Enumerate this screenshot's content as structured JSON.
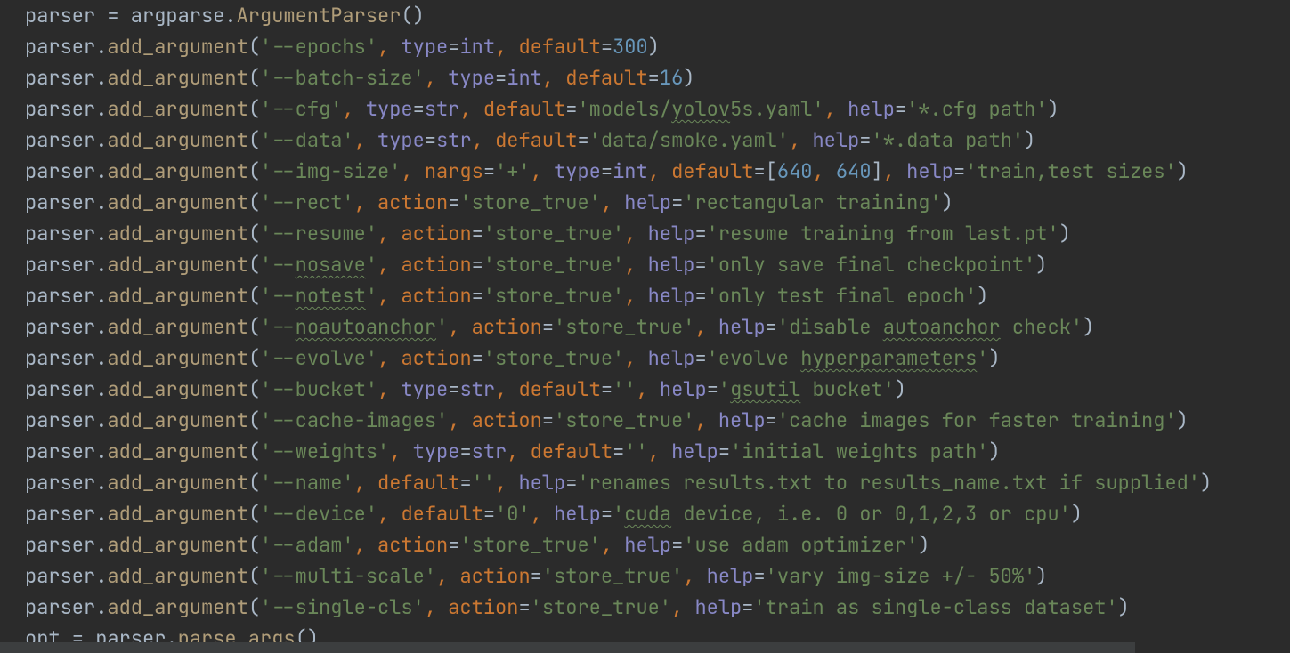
{
  "lines": [
    [
      {
        "t": "parser = argparse.",
        "c": "t-default"
      },
      {
        "t": "ArgumentParser",
        "c": "t-call"
      },
      {
        "t": "()",
        "c": "t-default"
      }
    ],
    [
      {
        "t": "parser.",
        "c": "t-default"
      },
      {
        "t": "add_argument",
        "c": "t-call"
      },
      {
        "t": "(",
        "c": "t-default"
      },
      {
        "t": "'--epochs'",
        "c": "t-string"
      },
      {
        "t": ", ",
        "c": "t-comma"
      },
      {
        "t": "type",
        "c": "t-builtin"
      },
      {
        "t": "=",
        "c": "t-default"
      },
      {
        "t": "int",
        "c": "t-builtin"
      },
      {
        "t": ", ",
        "c": "t-comma"
      },
      {
        "t": "default",
        "c": "t-keyword"
      },
      {
        "t": "=",
        "c": "t-default"
      },
      {
        "t": "300",
        "c": "t-number"
      },
      {
        "t": ")",
        "c": "t-default"
      }
    ],
    [
      {
        "t": "parser.",
        "c": "t-default"
      },
      {
        "t": "add_argument",
        "c": "t-call"
      },
      {
        "t": "(",
        "c": "t-default"
      },
      {
        "t": "'--batch-size'",
        "c": "t-string"
      },
      {
        "t": ", ",
        "c": "t-comma"
      },
      {
        "t": "type",
        "c": "t-builtin"
      },
      {
        "t": "=",
        "c": "t-default"
      },
      {
        "t": "int",
        "c": "t-builtin"
      },
      {
        "t": ", ",
        "c": "t-comma"
      },
      {
        "t": "default",
        "c": "t-keyword"
      },
      {
        "t": "=",
        "c": "t-default"
      },
      {
        "t": "16",
        "c": "t-number"
      },
      {
        "t": ")",
        "c": "t-default"
      }
    ],
    [
      {
        "t": "parser.",
        "c": "t-default"
      },
      {
        "t": "add_argument",
        "c": "t-call"
      },
      {
        "t": "(",
        "c": "t-default"
      },
      {
        "t": "'--cfg'",
        "c": "t-string"
      },
      {
        "t": ", ",
        "c": "t-comma"
      },
      {
        "t": "type",
        "c": "t-builtin"
      },
      {
        "t": "=",
        "c": "t-default"
      },
      {
        "t": "str",
        "c": "t-builtin"
      },
      {
        "t": ", ",
        "c": "t-comma"
      },
      {
        "t": "default",
        "c": "t-keyword"
      },
      {
        "t": "=",
        "c": "t-default"
      },
      {
        "t": "'models/",
        "c": "t-string"
      },
      {
        "t": "yolov",
        "c": "t-string typo"
      },
      {
        "t": "5s.yaml'",
        "c": "t-string"
      },
      {
        "t": ", ",
        "c": "t-comma"
      },
      {
        "t": "help",
        "c": "t-builtin"
      },
      {
        "t": "=",
        "c": "t-default"
      },
      {
        "t": "'*.cfg path'",
        "c": "t-string"
      },
      {
        "t": ")",
        "c": "t-default"
      }
    ],
    [
      {
        "t": "parser.",
        "c": "t-default"
      },
      {
        "t": "add_argument",
        "c": "t-call"
      },
      {
        "t": "(",
        "c": "t-default"
      },
      {
        "t": "'--data'",
        "c": "t-string"
      },
      {
        "t": ", ",
        "c": "t-comma"
      },
      {
        "t": "type",
        "c": "t-builtin"
      },
      {
        "t": "=",
        "c": "t-default"
      },
      {
        "t": "str",
        "c": "t-builtin"
      },
      {
        "t": ", ",
        "c": "t-comma"
      },
      {
        "t": "default",
        "c": "t-keyword"
      },
      {
        "t": "=",
        "c": "t-default"
      },
      {
        "t": "'data/smoke.yaml'",
        "c": "t-string"
      },
      {
        "t": ", ",
        "c": "t-comma"
      },
      {
        "t": "help",
        "c": "t-builtin"
      },
      {
        "t": "=",
        "c": "t-default"
      },
      {
        "t": "'*.data path'",
        "c": "t-string"
      },
      {
        "t": ")",
        "c": "t-default"
      }
    ],
    [
      {
        "t": "parser.",
        "c": "t-default"
      },
      {
        "t": "add_argument",
        "c": "t-call"
      },
      {
        "t": "(",
        "c": "t-default"
      },
      {
        "t": "'--img-size'",
        "c": "t-string"
      },
      {
        "t": ", ",
        "c": "t-comma"
      },
      {
        "t": "nargs",
        "c": "t-keyword"
      },
      {
        "t": "=",
        "c": "t-default"
      },
      {
        "t": "'+'",
        "c": "t-string"
      },
      {
        "t": ", ",
        "c": "t-comma"
      },
      {
        "t": "type",
        "c": "t-builtin"
      },
      {
        "t": "=",
        "c": "t-default"
      },
      {
        "t": "int",
        "c": "t-builtin"
      },
      {
        "t": ", ",
        "c": "t-comma"
      },
      {
        "t": "default",
        "c": "t-keyword"
      },
      {
        "t": "=[",
        "c": "t-default"
      },
      {
        "t": "640",
        "c": "t-number"
      },
      {
        "t": ", ",
        "c": "t-comma"
      },
      {
        "t": "640",
        "c": "t-number"
      },
      {
        "t": "]",
        "c": "t-default"
      },
      {
        "t": ", ",
        "c": "t-comma"
      },
      {
        "t": "help",
        "c": "t-builtin"
      },
      {
        "t": "=",
        "c": "t-default"
      },
      {
        "t": "'train,test sizes'",
        "c": "t-string"
      },
      {
        "t": ")",
        "c": "t-default"
      }
    ],
    [
      {
        "t": "parser.",
        "c": "t-default"
      },
      {
        "t": "add_argument",
        "c": "t-call"
      },
      {
        "t": "(",
        "c": "t-default"
      },
      {
        "t": "'--rect'",
        "c": "t-string"
      },
      {
        "t": ", ",
        "c": "t-comma"
      },
      {
        "t": "action",
        "c": "t-keyword"
      },
      {
        "t": "=",
        "c": "t-default"
      },
      {
        "t": "'store_true'",
        "c": "t-string"
      },
      {
        "t": ", ",
        "c": "t-comma"
      },
      {
        "t": "help",
        "c": "t-builtin"
      },
      {
        "t": "=",
        "c": "t-default"
      },
      {
        "t": "'rectangular training'",
        "c": "t-string"
      },
      {
        "t": ")",
        "c": "t-default"
      }
    ],
    [
      {
        "t": "parser.",
        "c": "t-default"
      },
      {
        "t": "add_argument",
        "c": "t-call"
      },
      {
        "t": "(",
        "c": "t-default"
      },
      {
        "t": "'--resume'",
        "c": "t-string"
      },
      {
        "t": ", ",
        "c": "t-comma"
      },
      {
        "t": "action",
        "c": "t-keyword"
      },
      {
        "t": "=",
        "c": "t-default"
      },
      {
        "t": "'store_true'",
        "c": "t-string"
      },
      {
        "t": ", ",
        "c": "t-comma"
      },
      {
        "t": "help",
        "c": "t-builtin"
      },
      {
        "t": "=",
        "c": "t-default"
      },
      {
        "t": "'resume training from last.pt'",
        "c": "t-string"
      },
      {
        "t": ")",
        "c": "t-default"
      }
    ],
    [
      {
        "t": "parser.",
        "c": "t-default"
      },
      {
        "t": "add_argument",
        "c": "t-call"
      },
      {
        "t": "(",
        "c": "t-default"
      },
      {
        "t": "'--",
        "c": "t-string"
      },
      {
        "t": "nosave",
        "c": "t-string typo"
      },
      {
        "t": "'",
        "c": "t-string"
      },
      {
        "t": ", ",
        "c": "t-comma"
      },
      {
        "t": "action",
        "c": "t-keyword"
      },
      {
        "t": "=",
        "c": "t-default"
      },
      {
        "t": "'store_true'",
        "c": "t-string"
      },
      {
        "t": ", ",
        "c": "t-comma"
      },
      {
        "t": "help",
        "c": "t-builtin"
      },
      {
        "t": "=",
        "c": "t-default"
      },
      {
        "t": "'only save final checkpoint'",
        "c": "t-string"
      },
      {
        "t": ")",
        "c": "t-default"
      }
    ],
    [
      {
        "t": "parser.",
        "c": "t-default"
      },
      {
        "t": "add_argument",
        "c": "t-call"
      },
      {
        "t": "(",
        "c": "t-default"
      },
      {
        "t": "'--",
        "c": "t-string"
      },
      {
        "t": "notest",
        "c": "t-string typo"
      },
      {
        "t": "'",
        "c": "t-string"
      },
      {
        "t": ", ",
        "c": "t-comma"
      },
      {
        "t": "action",
        "c": "t-keyword"
      },
      {
        "t": "=",
        "c": "t-default"
      },
      {
        "t": "'store_true'",
        "c": "t-string"
      },
      {
        "t": ", ",
        "c": "t-comma"
      },
      {
        "t": "help",
        "c": "t-builtin"
      },
      {
        "t": "=",
        "c": "t-default"
      },
      {
        "t": "'only test final epoch'",
        "c": "t-string"
      },
      {
        "t": ")",
        "c": "t-default"
      }
    ],
    [
      {
        "t": "parser.",
        "c": "t-default"
      },
      {
        "t": "add_argument",
        "c": "t-call"
      },
      {
        "t": "(",
        "c": "t-default"
      },
      {
        "t": "'--",
        "c": "t-string"
      },
      {
        "t": "noautoanchor",
        "c": "t-string typo"
      },
      {
        "t": "'",
        "c": "t-string"
      },
      {
        "t": ", ",
        "c": "t-comma"
      },
      {
        "t": "action",
        "c": "t-keyword"
      },
      {
        "t": "=",
        "c": "t-default"
      },
      {
        "t": "'store_true'",
        "c": "t-string"
      },
      {
        "t": ", ",
        "c": "t-comma"
      },
      {
        "t": "help",
        "c": "t-builtin"
      },
      {
        "t": "=",
        "c": "t-default"
      },
      {
        "t": "'disable ",
        "c": "t-string"
      },
      {
        "t": "autoanchor",
        "c": "t-string typo"
      },
      {
        "t": " check'",
        "c": "t-string"
      },
      {
        "t": ")",
        "c": "t-default"
      }
    ],
    [
      {
        "t": "parser.",
        "c": "t-default"
      },
      {
        "t": "add_argument",
        "c": "t-call"
      },
      {
        "t": "(",
        "c": "t-default"
      },
      {
        "t": "'--evolve'",
        "c": "t-string"
      },
      {
        "t": ", ",
        "c": "t-comma"
      },
      {
        "t": "action",
        "c": "t-keyword"
      },
      {
        "t": "=",
        "c": "t-default"
      },
      {
        "t": "'store_true'",
        "c": "t-string"
      },
      {
        "t": ", ",
        "c": "t-comma"
      },
      {
        "t": "help",
        "c": "t-builtin"
      },
      {
        "t": "=",
        "c": "t-default"
      },
      {
        "t": "'evolve ",
        "c": "t-string"
      },
      {
        "t": "hyperparameters",
        "c": "t-string typo"
      },
      {
        "t": "'",
        "c": "t-string"
      },
      {
        "t": ")",
        "c": "t-default"
      }
    ],
    [
      {
        "t": "parser.",
        "c": "t-default"
      },
      {
        "t": "add_argument",
        "c": "t-call"
      },
      {
        "t": "(",
        "c": "t-default"
      },
      {
        "t": "'--bucket'",
        "c": "t-string"
      },
      {
        "t": ", ",
        "c": "t-comma"
      },
      {
        "t": "type",
        "c": "t-builtin"
      },
      {
        "t": "=",
        "c": "t-default"
      },
      {
        "t": "str",
        "c": "t-builtin"
      },
      {
        "t": ", ",
        "c": "t-comma"
      },
      {
        "t": "default",
        "c": "t-keyword"
      },
      {
        "t": "=",
        "c": "t-default"
      },
      {
        "t": "''",
        "c": "t-string"
      },
      {
        "t": ", ",
        "c": "t-comma"
      },
      {
        "t": "help",
        "c": "t-builtin"
      },
      {
        "t": "=",
        "c": "t-default"
      },
      {
        "t": "'",
        "c": "t-string"
      },
      {
        "t": "gsutil",
        "c": "t-string typo"
      },
      {
        "t": " bucket'",
        "c": "t-string"
      },
      {
        "t": ")",
        "c": "t-default"
      }
    ],
    [
      {
        "t": "parser.",
        "c": "t-default"
      },
      {
        "t": "add_argument",
        "c": "t-call"
      },
      {
        "t": "(",
        "c": "t-default"
      },
      {
        "t": "'--cache-images'",
        "c": "t-string"
      },
      {
        "t": ", ",
        "c": "t-comma"
      },
      {
        "t": "action",
        "c": "t-keyword"
      },
      {
        "t": "=",
        "c": "t-default"
      },
      {
        "t": "'store_true'",
        "c": "t-string"
      },
      {
        "t": ", ",
        "c": "t-comma"
      },
      {
        "t": "help",
        "c": "t-builtin"
      },
      {
        "t": "=",
        "c": "t-default"
      },
      {
        "t": "'cache images for faster training'",
        "c": "t-string"
      },
      {
        "t": ")",
        "c": "t-default"
      }
    ],
    [
      {
        "t": "parser.",
        "c": "t-default"
      },
      {
        "t": "add_argument",
        "c": "t-call"
      },
      {
        "t": "(",
        "c": "t-default"
      },
      {
        "t": "'--weights'",
        "c": "t-string"
      },
      {
        "t": ", ",
        "c": "t-comma"
      },
      {
        "t": "type",
        "c": "t-builtin"
      },
      {
        "t": "=",
        "c": "t-default"
      },
      {
        "t": "str",
        "c": "t-builtin"
      },
      {
        "t": ", ",
        "c": "t-comma"
      },
      {
        "t": "default",
        "c": "t-keyword"
      },
      {
        "t": "=",
        "c": "t-default"
      },
      {
        "t": "''",
        "c": "t-string"
      },
      {
        "t": ", ",
        "c": "t-comma"
      },
      {
        "t": "help",
        "c": "t-builtin"
      },
      {
        "t": "=",
        "c": "t-default"
      },
      {
        "t": "'initial weights path'",
        "c": "t-string"
      },
      {
        "t": ")",
        "c": "t-default"
      }
    ],
    [
      {
        "t": "parser.",
        "c": "t-default"
      },
      {
        "t": "add_argument",
        "c": "t-call"
      },
      {
        "t": "(",
        "c": "t-default"
      },
      {
        "t": "'--name'",
        "c": "t-string"
      },
      {
        "t": ", ",
        "c": "t-comma"
      },
      {
        "t": "default",
        "c": "t-keyword"
      },
      {
        "t": "=",
        "c": "t-default"
      },
      {
        "t": "''",
        "c": "t-string"
      },
      {
        "t": ", ",
        "c": "t-comma"
      },
      {
        "t": "help",
        "c": "t-builtin"
      },
      {
        "t": "=",
        "c": "t-default"
      },
      {
        "t": "'renames results.txt to results_name.txt if supplied'",
        "c": "t-string"
      },
      {
        "t": ")",
        "c": "t-default"
      }
    ],
    [
      {
        "t": "parser.",
        "c": "t-default"
      },
      {
        "t": "add_argument",
        "c": "t-call"
      },
      {
        "t": "(",
        "c": "t-default"
      },
      {
        "t": "'--device'",
        "c": "t-string"
      },
      {
        "t": ", ",
        "c": "t-comma"
      },
      {
        "t": "default",
        "c": "t-keyword"
      },
      {
        "t": "=",
        "c": "t-default"
      },
      {
        "t": "'0'",
        "c": "t-string"
      },
      {
        "t": ", ",
        "c": "t-comma"
      },
      {
        "t": "help",
        "c": "t-builtin"
      },
      {
        "t": "=",
        "c": "t-default"
      },
      {
        "t": "'",
        "c": "t-string"
      },
      {
        "t": "cuda",
        "c": "t-string typo"
      },
      {
        "t": " device, i.e. 0 or 0,1,2,3 or cpu'",
        "c": "t-string"
      },
      {
        "t": ")",
        "c": "t-default"
      }
    ],
    [
      {
        "t": "parser.",
        "c": "t-default"
      },
      {
        "t": "add_argument",
        "c": "t-call"
      },
      {
        "t": "(",
        "c": "t-default"
      },
      {
        "t": "'--adam'",
        "c": "t-string"
      },
      {
        "t": ", ",
        "c": "t-comma"
      },
      {
        "t": "action",
        "c": "t-keyword"
      },
      {
        "t": "=",
        "c": "t-default"
      },
      {
        "t": "'store_true'",
        "c": "t-string"
      },
      {
        "t": ", ",
        "c": "t-comma"
      },
      {
        "t": "help",
        "c": "t-builtin"
      },
      {
        "t": "=",
        "c": "t-default"
      },
      {
        "t": "'use adam optimizer'",
        "c": "t-string"
      },
      {
        "t": ")",
        "c": "t-default"
      }
    ],
    [
      {
        "t": "parser.",
        "c": "t-default"
      },
      {
        "t": "add_argument",
        "c": "t-call"
      },
      {
        "t": "(",
        "c": "t-default"
      },
      {
        "t": "'--multi-scale'",
        "c": "t-string"
      },
      {
        "t": ", ",
        "c": "t-comma"
      },
      {
        "t": "action",
        "c": "t-keyword"
      },
      {
        "t": "=",
        "c": "t-default"
      },
      {
        "t": "'store_true'",
        "c": "t-string"
      },
      {
        "t": ", ",
        "c": "t-comma"
      },
      {
        "t": "help",
        "c": "t-builtin"
      },
      {
        "t": "=",
        "c": "t-default"
      },
      {
        "t": "'vary img-size +/- 50%'",
        "c": "t-string"
      },
      {
        "t": ")",
        "c": "t-default"
      }
    ],
    [
      {
        "t": "parser.",
        "c": "t-default"
      },
      {
        "t": "add_argument",
        "c": "t-call"
      },
      {
        "t": "(",
        "c": "t-default"
      },
      {
        "t": "'--single-cls'",
        "c": "t-string"
      },
      {
        "t": ", ",
        "c": "t-comma"
      },
      {
        "t": "action",
        "c": "t-keyword"
      },
      {
        "t": "=",
        "c": "t-default"
      },
      {
        "t": "'store_true'",
        "c": "t-string"
      },
      {
        "t": ", ",
        "c": "t-comma"
      },
      {
        "t": "help",
        "c": "t-builtin"
      },
      {
        "t": "=",
        "c": "t-default"
      },
      {
        "t": "'train as single-class dataset'",
        "c": "t-string"
      },
      {
        "t": ")",
        "c": "t-default"
      }
    ],
    [
      {
        "t": "opt = parser.",
        "c": "t-default"
      },
      {
        "t": "parse_args",
        "c": "t-call"
      },
      {
        "t": "()",
        "c": "t-default"
      }
    ]
  ]
}
